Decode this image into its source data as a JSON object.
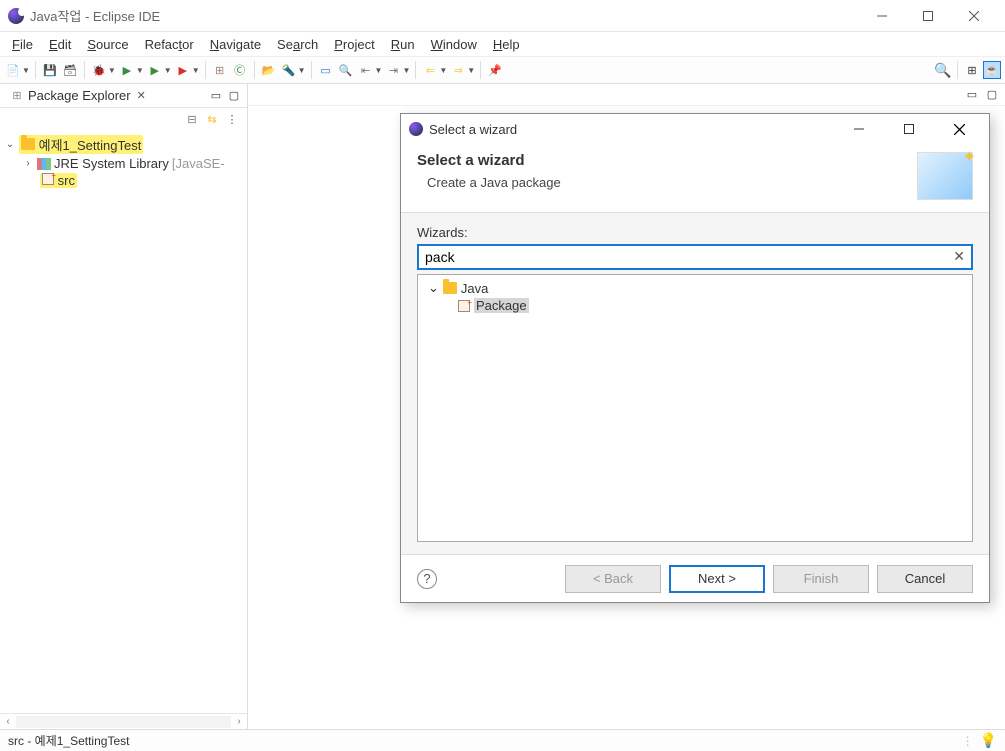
{
  "window": {
    "title": "Java작업 - Eclipse IDE"
  },
  "menubar": {
    "file": "File",
    "edit": "Edit",
    "source": "Source",
    "refactor": "Refactor",
    "navigate": "Navigate",
    "search": "Search",
    "project": "Project",
    "run": "Run",
    "window": "Window",
    "help": "Help"
  },
  "pkgExplorer": {
    "title": "Package Explorer",
    "tree": {
      "project": "예제1_SettingTest",
      "jre": "JRE System Library",
      "jreSuffix": "[JavaSE-",
      "src": "src"
    }
  },
  "dialog": {
    "title": "Select a wizard",
    "bannerTitle": "Select a wizard",
    "bannerDesc": "Create a Java package",
    "wizardsLabel": "Wizards:",
    "filterValue": "pack",
    "tree": {
      "java": "Java",
      "package": "Package"
    },
    "buttons": {
      "back": "< Back",
      "next": "Next >",
      "finish": "Finish",
      "cancel": "Cancel"
    }
  },
  "statusbar": {
    "text": "src - 예제1_SettingTest"
  }
}
